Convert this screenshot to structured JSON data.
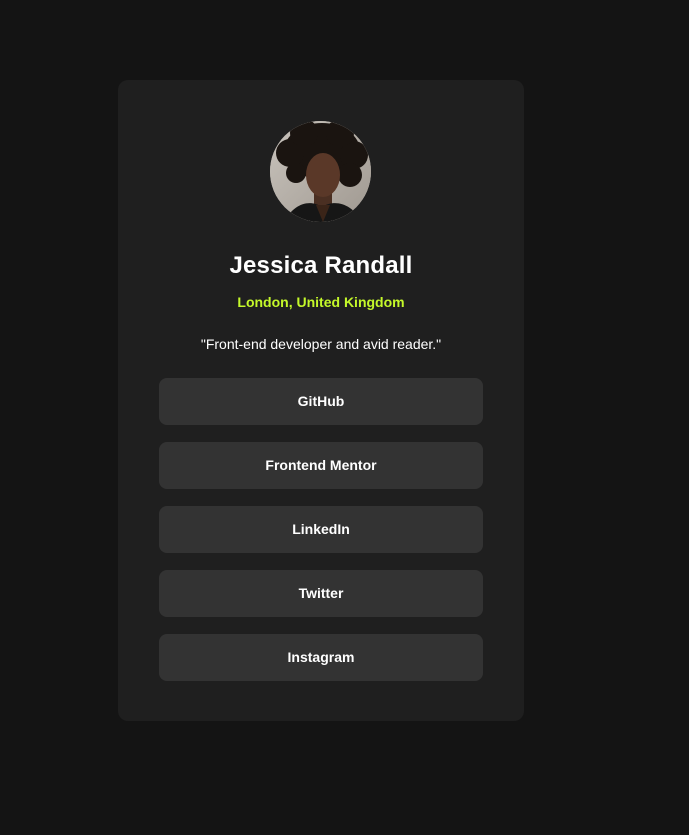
{
  "profile": {
    "name": "Jessica Randall",
    "location": "London, United Kingdom",
    "bio": "\"Front-end developer and avid reader.\""
  },
  "links": [
    {
      "label": "GitHub"
    },
    {
      "label": "Frontend Mentor"
    },
    {
      "label": "LinkedIn"
    },
    {
      "label": "Twitter"
    },
    {
      "label": "Instagram"
    }
  ],
  "colors": {
    "page_background": "#141414",
    "card_background": "#1f1f1f",
    "button_background": "#333333",
    "accent": "#c4f82a",
    "text": "#ffffff"
  }
}
